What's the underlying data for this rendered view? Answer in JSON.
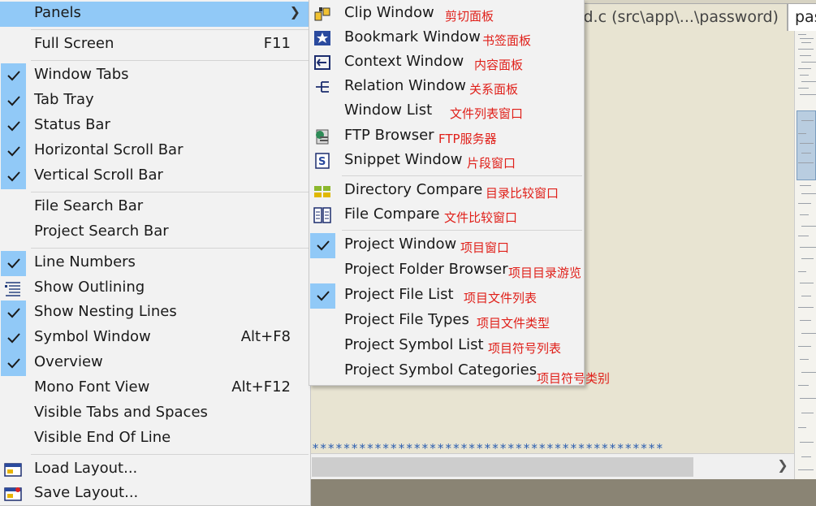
{
  "background": {
    "tab_active": "rd.c (src\\app\\...\\password)",
    "tab_next": "pas",
    "code_stars": "*********************************************"
  },
  "main_menu": {
    "panels": "Panels",
    "full_screen": "Full Screen",
    "full_screen_key": "F11",
    "window_tabs": "Window Tabs",
    "tab_tray": "Tab Tray",
    "status_bar": "Status Bar",
    "horizontal_scroll_bar": "Horizontal Scroll Bar",
    "vertical_scroll_bar": "Vertical Scroll Bar",
    "file_search_bar": "File Search Bar",
    "project_search_bar": "Project Search Bar",
    "line_numbers": "Line Numbers",
    "show_outlining": "Show Outlining",
    "show_nesting_lines": "Show Nesting Lines",
    "symbol_window": "Symbol Window",
    "symbol_window_key": "Alt+F8",
    "overview": "Overview",
    "mono_font_view": "Mono Font View",
    "mono_font_view_key": "Alt+F12",
    "visible_tabs_spaces": "Visible Tabs and Spaces",
    "visible_end_of_line": "Visible End Of Line",
    "load_layout": "Load Layout...",
    "save_layout": "Save Layout..."
  },
  "sub_menu": {
    "clip_window": "Clip Window",
    "clip_window_zh": "剪切面板",
    "bookmark_window": "Bookmark Window",
    "bookmark_window_zh": "书签面板",
    "context_window": "Context Window",
    "context_window_zh": "内容面板",
    "relation_window": "Relation Window",
    "relation_window_zh": "关系面板",
    "window_list": "Window List",
    "window_list_zh": "文件列表窗口",
    "ftp_browser": "FTP Browser",
    "ftp_browser_zh": "FTP服务器",
    "snippet_window": "Snippet Window",
    "snippet_window_zh": "片段窗口",
    "directory_compare": "Directory Compare",
    "directory_compare_zh": "目录比较窗口",
    "file_compare": "File Compare",
    "file_compare_zh": "文件比较窗口",
    "project_window": "Project Window",
    "project_window_zh": "项目窗口",
    "project_folder_browser": "Project Folder Browser",
    "project_folder_browser_zh": "项目目录游览",
    "project_file_list": "Project File List",
    "project_file_list_zh": "项目文件列表",
    "project_file_types": "Project File Types",
    "project_file_types_zh": "项目文件类型",
    "project_symbol_list": "Project Symbol List",
    "project_symbol_list_zh": "项目符号列表",
    "project_symbol_categories": "Project Symbol Categories",
    "project_symbol_categories_zh": "项目符号类别"
  },
  "icons": {
    "checkmark": "check-icon",
    "submenu_arrow": "chevron-right-icon",
    "hscroll_right": "chevron-right-icon"
  },
  "colors": {
    "highlight": "#91c9f7",
    "annotation_red": "#e0201a",
    "code_blue": "#2a5db0"
  }
}
